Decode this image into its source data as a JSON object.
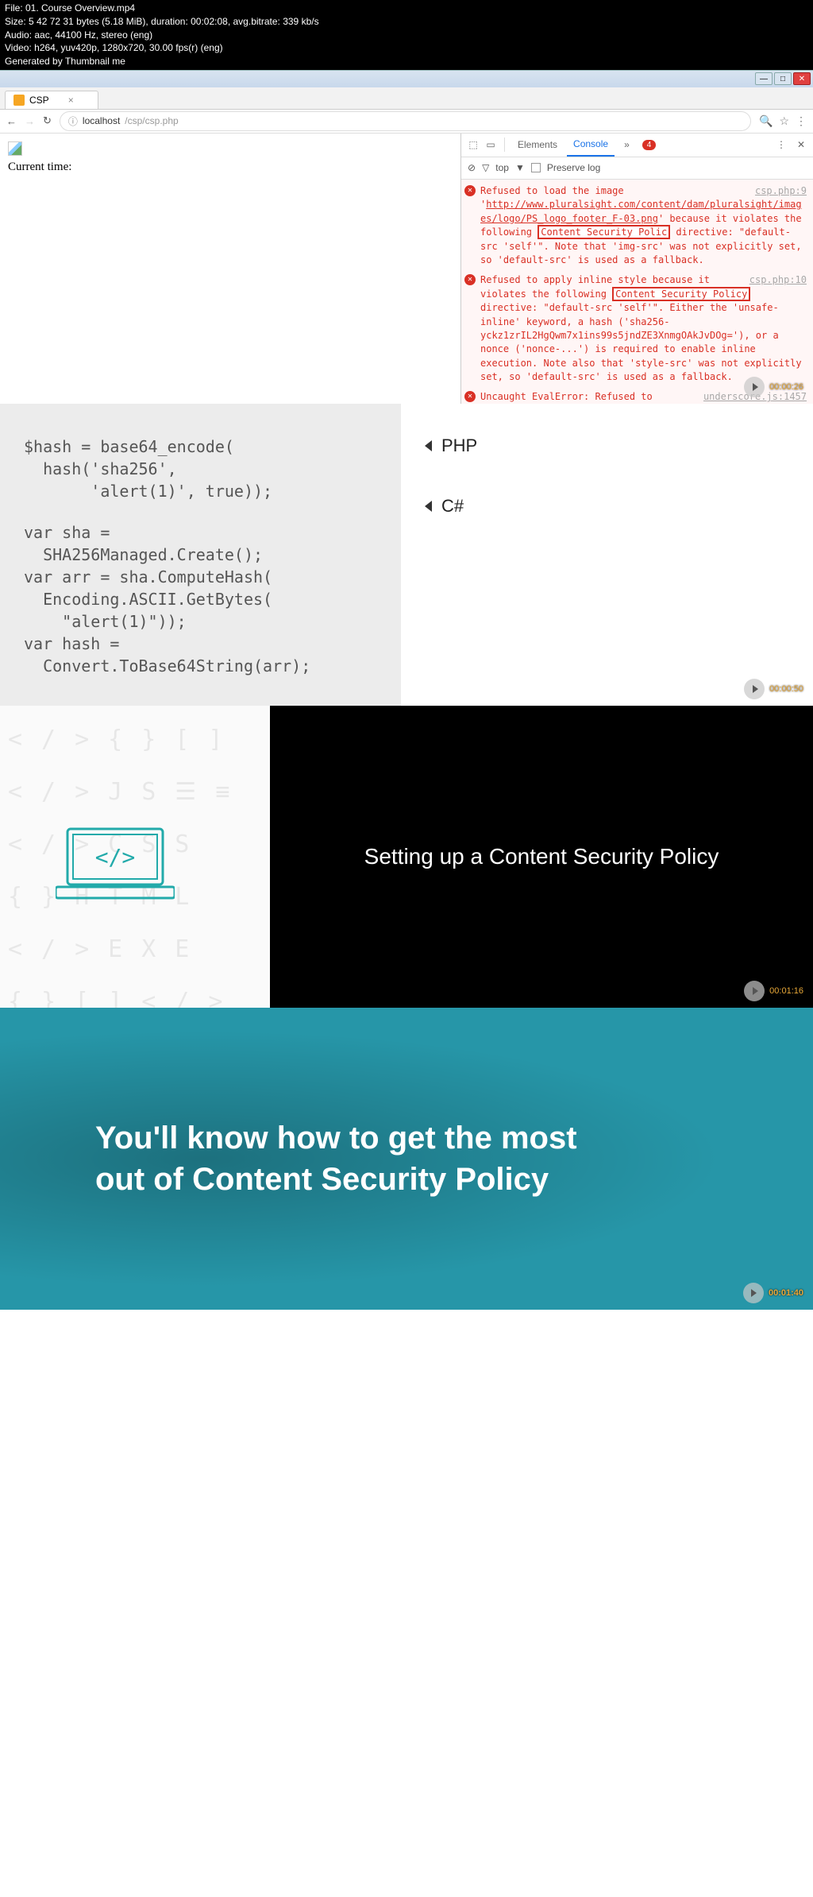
{
  "header": {
    "file": "File: 01. Course Overview.mp4",
    "size": "Size: 5 42 72 31 bytes (5.18 MiB), duration: 00:02:08, avg.bitrate: 339 kb/s",
    "audio": "Audio: aac, 44100 Hz, stereo (eng)",
    "video": "Video: h264, yuv420p, 1280x720, 30.00 fps(r) (eng)",
    "gen": "Generated by Thumbnail me"
  },
  "browser": {
    "tab_title": "CSP",
    "url_host": "localhost",
    "url_path": "/csp/csp.php",
    "info_icon": "ⓘ"
  },
  "page": {
    "current_time": "Current time:"
  },
  "devtools": {
    "tabs": {
      "elements": "Elements",
      "console": "Console",
      "more": "»"
    },
    "error_count": "4",
    "filter": {
      "top": "top",
      "preserve": "Preserve log"
    },
    "msg1": {
      "pre": "Refused to load the image '",
      "url": "http://www.pluralsight.com/content/dam/pluralsight/images/logo/PS_logo_footer_F-03.png",
      "mid": "' because it violates the following ",
      "csp": "Content Security Polic",
      "post": " directive: \"default-src 'self'\". Note that 'img-src' was not explicitly set, so 'default-src' is used as a fallback.",
      "src": "csp.php:9"
    },
    "msg2": {
      "pre": "Refused to apply inline style because it violates the following ",
      "csp": "Content Security Policy",
      "post": " directive: \"default-src 'self'\". Either the 'unsafe-inline' keyword, a hash ('sha256-yckz1zrIL2HgQwm7x1ins99s5jndZE3XnmgOAkJvDOg='), or a nonce ('nonce-...') is required to enable inline execution. Note also that 'style-src' was not explicitly set, so 'default-src' is used as a fallback.",
      "src": "csp.php:10"
    },
    "msg3": {
      "text": "Uncaught EvalError: Refused to evaluate a string as",
      "src": "underscore.js:1457"
    }
  },
  "slide2": {
    "code_php": "$hash = base64_encode(\n  hash('sha256',\n       'alert(1)', true));",
    "code_cs": "var sha =\n  SHA256Managed.Create();\nvar arr = sha.ComputeHash(\n  Encoding.ASCII.GetBytes(\n    \"alert(1)\"));\nvar hash =\n  Convert.ToBase64String(arr);",
    "lang_php": "PHP",
    "lang_cs": "C#",
    "ts": "00:00:50"
  },
  "slide3": {
    "title": "Setting up a Content Security Policy",
    "ts": "00:01:16"
  },
  "slide4": {
    "line1": "You'll know how to get the most",
    "line2": "out of Content Security Policy",
    "ts": "00:01:40"
  },
  "ts1": "00:00:26"
}
